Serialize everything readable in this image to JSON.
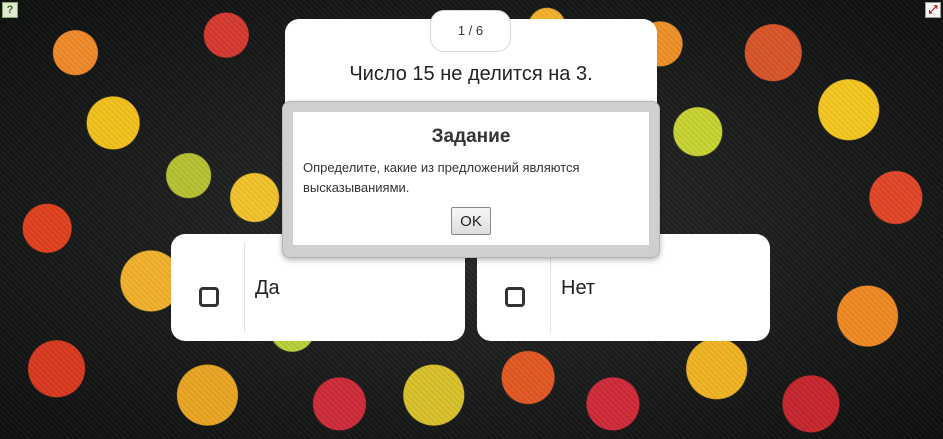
{
  "toolbar": {
    "help_icon": "help-icon",
    "fullscreen_icon": "fullscreen-icon",
    "help_glyph": "?",
    "fullscreen_glyph": "⤢"
  },
  "question": {
    "counter": "1 / 6",
    "text": "Число 15 не делится на 3."
  },
  "answers": [
    {
      "label": "Да",
      "checked": false
    },
    {
      "label": "Нет",
      "checked": false
    }
  ],
  "modal": {
    "title": "Задание",
    "body": "Определите, какие из предложений являются высказываниями.",
    "ok_label": "OK"
  },
  "colors": {
    "card_bg": "#ffffff",
    "modal_frame": "#cfcfcf",
    "text": "#222222"
  }
}
